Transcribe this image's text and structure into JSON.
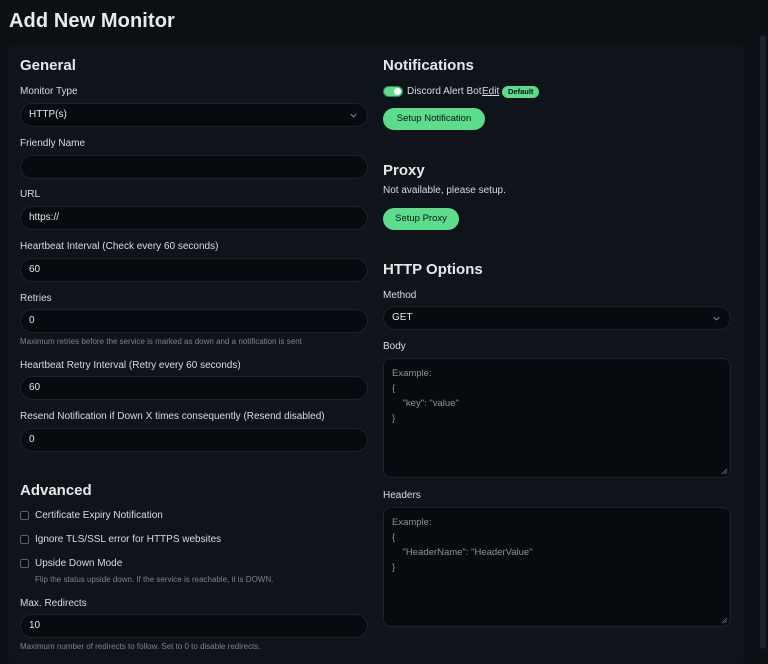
{
  "page": {
    "title": "Add New Monitor"
  },
  "general": {
    "heading": "General",
    "monitor_type": {
      "label": "Monitor Type",
      "value": "HTTP(s)"
    },
    "friendly_name": {
      "label": "Friendly Name",
      "value": ""
    },
    "url": {
      "label": "URL",
      "value": "https://"
    },
    "heartbeat_interval": {
      "label": "Heartbeat Interval (Check every 60 seconds)",
      "value": "60"
    },
    "retries": {
      "label": "Retries",
      "value": "0",
      "hint": "Maximum retries before the service is marked as down and a notification is sent"
    },
    "retry_interval": {
      "label": "Heartbeat Retry Interval (Retry every 60 seconds)",
      "value": "60"
    },
    "resend": {
      "label": "Resend Notification if Down X times consequently (Resend disabled)",
      "value": "0"
    }
  },
  "advanced": {
    "heading": "Advanced",
    "cert_expiry": {
      "label": "Certificate Expiry Notification",
      "checked": false
    },
    "ignore_tls": {
      "label": "Ignore TLS/SSL error for HTTPS websites",
      "checked": false
    },
    "upside_down": {
      "label": "Upside Down Mode",
      "checked": false,
      "hint": "Flip the status upside down. If the service is reachable, it is DOWN."
    },
    "max_redirects": {
      "label": "Max. Redirects",
      "value": "10",
      "hint": "Maximum number of redirects to follow. Set to 0 to disable redirects."
    }
  },
  "notifications": {
    "heading": "Notifications",
    "item": {
      "name": "Discord Alert Bot",
      "edit_label": "Edit",
      "badge": "Default",
      "enabled": true
    },
    "setup_label": "Setup Notification"
  },
  "proxy": {
    "heading": "Proxy",
    "status": "Not available, please setup.",
    "setup_label": "Setup Proxy"
  },
  "http_options": {
    "heading": "HTTP Options",
    "method": {
      "label": "Method",
      "value": "GET"
    },
    "body": {
      "label": "Body",
      "placeholder_lines": [
        "Example:",
        "{",
        "    \"key\": \"value\"",
        "}"
      ]
    },
    "headers": {
      "label": "Headers",
      "placeholder_lines": [
        "Example:",
        "{",
        "    \"HeaderName\": \"HeaderValue\"",
        "}"
      ]
    }
  },
  "theme": {
    "accent": "#5cdd8b",
    "background": "#0c0f14",
    "panel": "#0f131a",
    "input": "#070a0f"
  },
  "icons": {
    "select_chevron": "chevron-down-icon",
    "resize_grip": "resize-grip-icon"
  }
}
